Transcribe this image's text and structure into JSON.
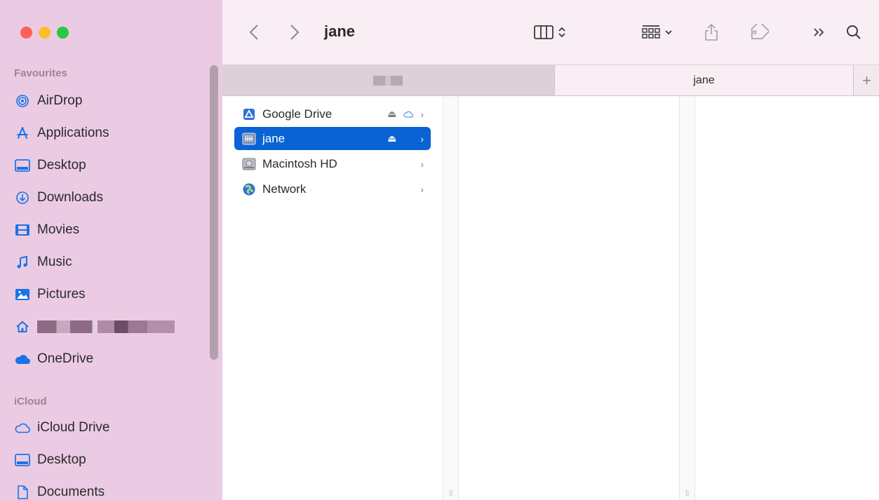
{
  "window": {
    "title": "jane"
  },
  "sidebar": {
    "sections": {
      "favourites": "Favourites",
      "icloud": "iCloud"
    },
    "favourites": [
      {
        "label": "AirDrop",
        "icon": "airdrop-icon"
      },
      {
        "label": "Applications",
        "icon": "applications-icon"
      },
      {
        "label": "Desktop",
        "icon": "desktop-icon"
      },
      {
        "label": "Downloads",
        "icon": "downloads-icon"
      },
      {
        "label": "Movies",
        "icon": "movies-icon"
      },
      {
        "label": "Music",
        "icon": "music-icon"
      },
      {
        "label": "Pictures",
        "icon": "pictures-icon"
      },
      {
        "label": "",
        "icon": "home-icon",
        "redacted": true
      },
      {
        "label": "OneDrive",
        "icon": "cloud-icon"
      }
    ],
    "icloud": [
      {
        "label": "iCloud Drive",
        "icon": "icloud-icon"
      },
      {
        "label": "Desktop",
        "icon": "desktop-icon"
      },
      {
        "label": "Documents",
        "icon": "document-icon"
      }
    ]
  },
  "tabs": [
    {
      "label": "",
      "active": false,
      "redacted": true
    },
    {
      "label": "jane",
      "active": true
    }
  ],
  "tab_add": "+",
  "columns": [
    {
      "items": [
        {
          "label": "Google Drive",
          "icon": "google-drive-icon",
          "eject": true,
          "cloud": true,
          "selected": false
        },
        {
          "label": "jane",
          "icon": "network-drive-icon",
          "eject": true,
          "cloud": false,
          "selected": true
        },
        {
          "label": "Macintosh HD",
          "icon": "hard-disk-icon",
          "eject": false,
          "cloud": false,
          "selected": false
        },
        {
          "label": "Network",
          "icon": "network-globe-icon",
          "eject": false,
          "cloud": false,
          "selected": false
        }
      ]
    }
  ],
  "colors": {
    "sidebar_bg": "#ebcbe3",
    "accent": "#0a63d4",
    "icon_blue": "#1a73e8"
  }
}
